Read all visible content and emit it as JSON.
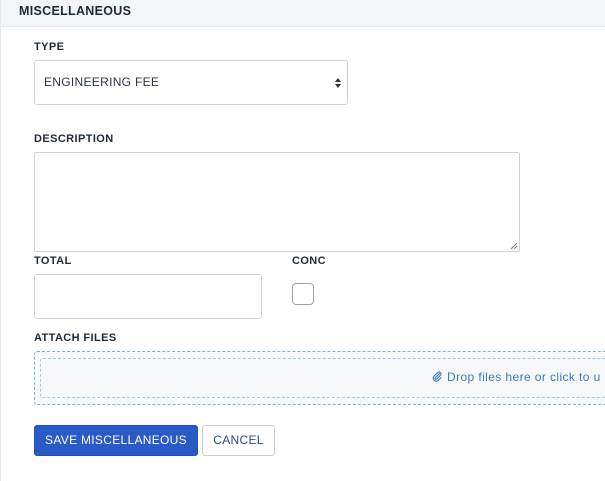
{
  "section": {
    "title": "MISCELLANEOUS"
  },
  "form": {
    "type_label": "TYPE",
    "type_value": "ENGINEERING FEE",
    "description_label": "DESCRIPTION",
    "description_value": "",
    "total_label": "TOTAL",
    "total_value": "",
    "conc_label": "CONC",
    "conc_checked": false,
    "attach_label": "ATTACH FILES",
    "dropzone_text": "Drop files here or click to u"
  },
  "actions": {
    "save_label": "SAVE MISCELLANEOUS",
    "cancel_label": "CANCEL"
  },
  "icons": {
    "select_arrows": "sort-arrows-icon",
    "resize": "resize-grip-icon",
    "attach": "paperclip-icon"
  },
  "colors": {
    "primary": "#2a59c8",
    "dropzone_border": "#7fb1d8",
    "dropzone_text": "#3a79b5"
  }
}
